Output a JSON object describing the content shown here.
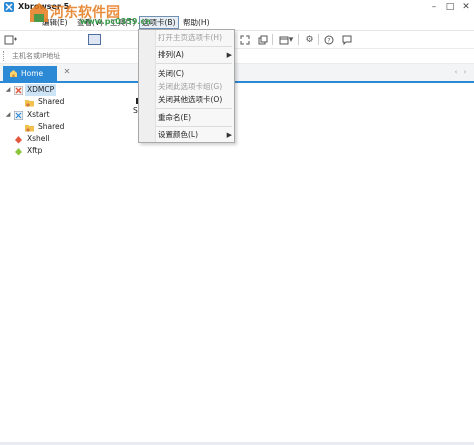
{
  "app": {
    "title": "Xbrowser 5"
  },
  "watermark": {
    "text": "河东软件园",
    "url": "www.pc0359.cn"
  },
  "menubar": {
    "items": [
      {
        "label": "编辑(E)"
      },
      {
        "label": "查看(V)"
      },
      {
        "label": "工具(T)"
      },
      {
        "label": "选项卡(B)"
      },
      {
        "label": "帮助(H)"
      }
    ]
  },
  "address": {
    "placeholder": "主机名或IP地址"
  },
  "tab": {
    "label": "Home"
  },
  "tree": {
    "items": [
      {
        "label": "XDMCP"
      },
      {
        "label": "Shared"
      },
      {
        "label": "Xstart"
      },
      {
        "label": "Shared"
      },
      {
        "label": "Xshell"
      },
      {
        "label": "Xftp"
      }
    ]
  },
  "content": {
    "partial_label": "Sh"
  },
  "dropdown": {
    "items": [
      {
        "label": "打开主页选项卡(H)",
        "disabled": true
      },
      {
        "label": "排列(A)",
        "submenu": true
      },
      {
        "label": "关闭(C)"
      },
      {
        "label": "关闭此选项卡组(G)",
        "disabled": true
      },
      {
        "label": "关闭其他选项卡(O)"
      },
      {
        "label": "重命名(E)"
      },
      {
        "label": "设置颜色(L)",
        "submenu": true
      }
    ]
  },
  "colors": {
    "accent": "#2c89d6",
    "menu_bg": "#f7f7f7",
    "disabled": "#9b9b9b"
  }
}
